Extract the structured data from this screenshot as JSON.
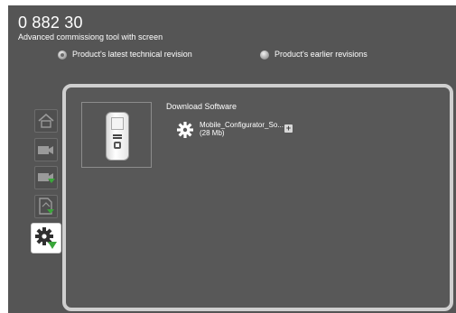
{
  "header": {
    "title": "0 882 30",
    "subtitle": "Advanced commissiong tool with screen"
  },
  "revisions": {
    "latest_label": "Product's latest technical revision",
    "earlier_label": "Product's earlier revisions",
    "selected": "latest"
  },
  "sidebar": {
    "items": [
      {
        "name": "home",
        "icon": "home-icon",
        "active": false
      },
      {
        "name": "camera",
        "icon": "camera-icon",
        "active": false
      },
      {
        "name": "camera-download",
        "icon": "camera-download-icon",
        "active": false
      },
      {
        "name": "document-download",
        "icon": "document-download-icon",
        "active": false
      },
      {
        "name": "software-download",
        "icon": "gear-download-icon",
        "active": true
      }
    ]
  },
  "main": {
    "section_title": "Download Software",
    "file": {
      "name": "Mobile_Configurator_So...",
      "size": "(28 Mb)",
      "add_label": "+"
    }
  },
  "colors": {
    "background": "#555555",
    "panel_border": "#cfcfcf",
    "text": "#ffffff",
    "accent_green": "#3aa63a"
  }
}
